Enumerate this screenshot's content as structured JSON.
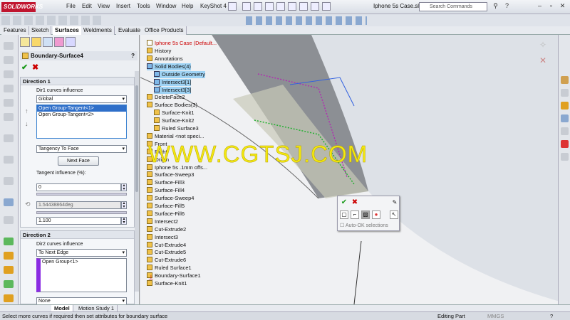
{
  "app": {
    "brand": "SOLIDWORKS",
    "document_title": "Iphone 5s Case.sl...",
    "search_placeholder": "Search Commands"
  },
  "menu": [
    "File",
    "Edit",
    "View",
    "Insert",
    "Tools",
    "Window",
    "Help",
    "KeyShot 4"
  ],
  "command_tabs": [
    "Features",
    "Sketch",
    "Surfaces",
    "Weldments",
    "Evaluate",
    "Office Products"
  ],
  "active_command_tab": "Surfaces",
  "property_manager": {
    "feature_name": "Boundary-Surface4",
    "direction1": {
      "title": "Direction 1",
      "influence_label": "Dir1 curves influence",
      "influence_value": "Global",
      "curves": [
        "Open Group-Tangent<1>",
        "Open Group-Tangent<2>"
      ],
      "tangency_value": "Tangency To Face",
      "next_face_label": "Next Face",
      "tangent_influence_label": "Tangent influence (%):",
      "tangent_influence_value": "0",
      "angle_value": "1.54438864deg",
      "length_value": "1.100"
    },
    "direction2": {
      "title": "Direction 2",
      "influence_label": "Dir2 curves influence",
      "influence_value": "To Next Edge",
      "curves": [
        "Open Group<1>"
      ],
      "tangency_value": "None"
    }
  },
  "tree": {
    "root": "Iphone 5s Case  (Default...",
    "items": [
      {
        "label": "History",
        "sel": false
      },
      {
        "label": "Annotations",
        "sel": false
      },
      {
        "label": "Solid Bodies(4)",
        "sel": true
      },
      {
        "label": "Outside Geometry",
        "sel": true
      },
      {
        "label": "Intersect3[1]",
        "sel": true
      },
      {
        "label": "Intersect3[3]",
        "sel": true
      },
      {
        "label": "DeleteFace2",
        "sel": false
      },
      {
        "label": "Surface Bodies(3)",
        "sel": false
      },
      {
        "label": "Surface-Knit1",
        "sel": false
      },
      {
        "label": "Surface-Knit2",
        "sel": false
      },
      {
        "label": "Ruled Surface3",
        "sel": false
      },
      {
        "label": "Material <not speci...",
        "sel": false
      },
      {
        "label": "Front",
        "sel": false
      },
      {
        "label": "Right",
        "sel": false
      },
      {
        "label": "Origin",
        "sel": false
      },
      {
        "label": "Iphone 5s .1mm offs...",
        "sel": false
      },
      {
        "label": "Surface-Sweep3",
        "sel": false
      },
      {
        "label": "Surface-Fill3",
        "sel": false
      },
      {
        "label": "Surface-Fill4",
        "sel": false
      },
      {
        "label": "Surface-Sweep4",
        "sel": false
      },
      {
        "label": "Surface-Fill5",
        "sel": false
      },
      {
        "label": "Surface-Fill6",
        "sel": false
      },
      {
        "label": "Intersect2",
        "sel": false
      },
      {
        "label": "Cut-Extrude2",
        "sel": false
      },
      {
        "label": "Intersect3",
        "sel": false
      },
      {
        "label": "Cut-Extrude4",
        "sel": false
      },
      {
        "label": "Cut-Extrude5",
        "sel": false
      },
      {
        "label": "Cut-Extrude6",
        "sel": false
      },
      {
        "label": "Ruled Surface1",
        "sel": false
      },
      {
        "label": "Boundary-Surface1",
        "sel": false
      },
      {
        "label": "Surface-Knit1",
        "sel": false
      }
    ]
  },
  "watermark": "WWW.CGTSJ.COM",
  "popup": {
    "auto_ok_label": "Auto-OK selections"
  },
  "bottom_tabs": [
    "Model",
    "Motion Study 1"
  ],
  "status": {
    "message": "Select more curves if required then set attributes for boundary surface",
    "mode": "Editing Part",
    "units": "MMGS"
  },
  "colors": {
    "brand_red": "#c0152f",
    "selection_blue": "#9fd3f4",
    "watermark_yellow": "#f3e810"
  }
}
